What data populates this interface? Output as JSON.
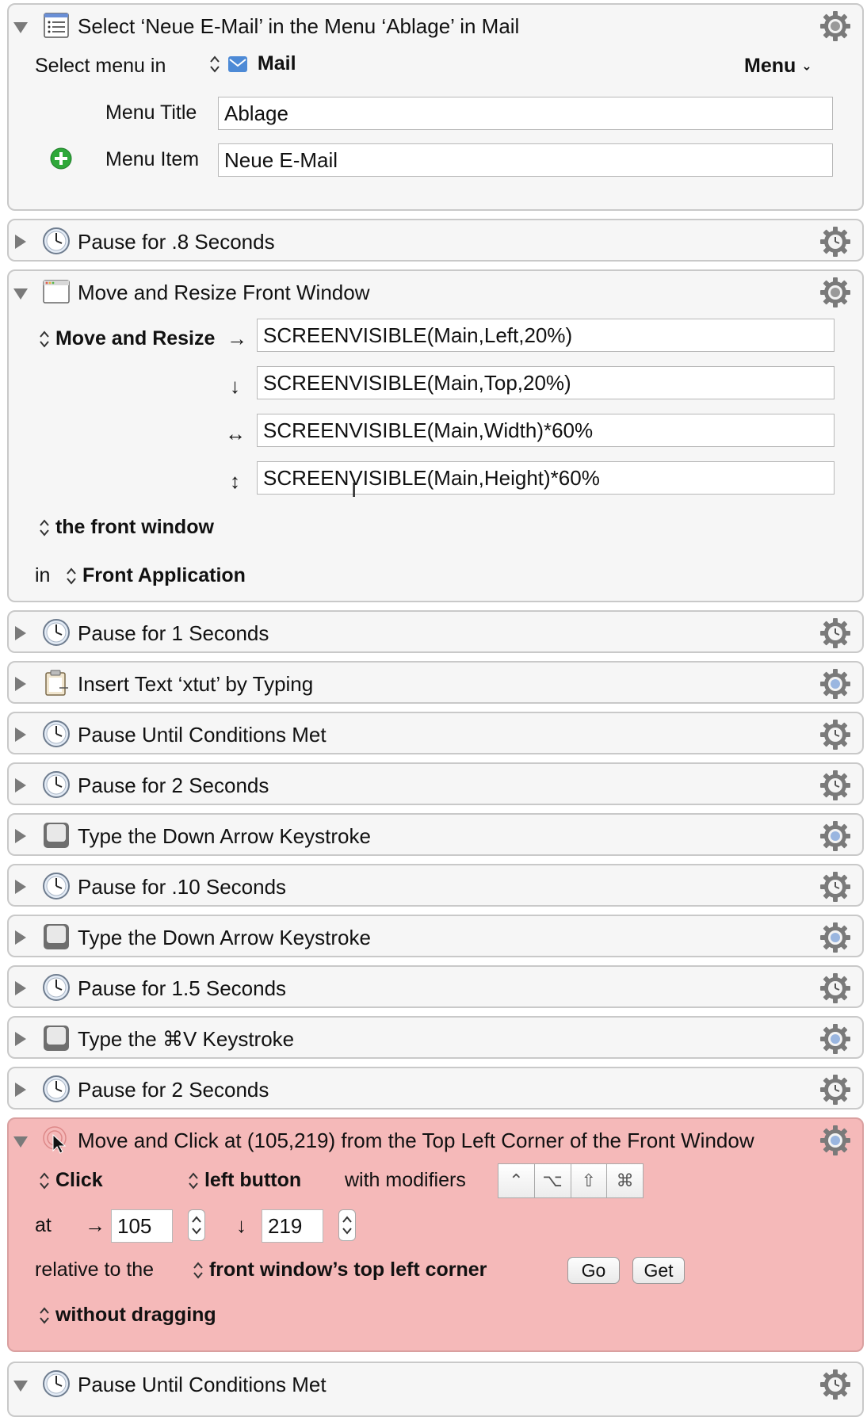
{
  "actions": [
    {
      "id": "a1",
      "title": "Select ‘Neue E-Mail’ in the Menu ‘Ablage’ in Mail",
      "icon": "menu-list-icon",
      "select_menu_label": "Select menu in",
      "app_name": "Mail",
      "menu_popup": "Menu",
      "menu_title_label": "Menu Title",
      "menu_title_value": "Ablage",
      "menu_item_label": "Menu Item",
      "menu_item_value": "Neue E-Mail"
    },
    {
      "id": "a2",
      "title": "Pause for .8 Seconds",
      "icon": "clock-icon"
    },
    {
      "id": "a3",
      "title": "Move and Resize Front Window",
      "icon": "window-icon",
      "mode": "Move and Resize",
      "left_value": "SCREENVISIBLE(Main,Left,20%)",
      "top_value": "SCREENVISIBLE(Main,Top,20%)",
      "width_value": "SCREENVISIBLE(Main,Width)*60%",
      "height_value": "SCREENVISIBLE(Main,Height)*60%",
      "target_window": "the front window",
      "in_label": "in",
      "target_app": "Front Application"
    },
    {
      "id": "a4",
      "title": "Pause for 1 Seconds",
      "icon": "clock-icon"
    },
    {
      "id": "a5",
      "title": "Insert Text ‘xtut’ by Typing",
      "icon": "clipboard-icon"
    },
    {
      "id": "a6",
      "title": "Pause Until Conditions Met",
      "icon": "clock-icon"
    },
    {
      "id": "a7",
      "title": "Pause for 2 Seconds",
      "icon": "clock-icon"
    },
    {
      "id": "a8",
      "title": "Type the Down Arrow Keystroke",
      "icon": "keycap-icon"
    },
    {
      "id": "a9",
      "title": "Pause for .10 Seconds",
      "icon": "clock-icon"
    },
    {
      "id": "a10",
      "title": "Type the Down Arrow Keystroke",
      "icon": "keycap-icon"
    },
    {
      "id": "a11",
      "title": "Pause for 1.5 Seconds",
      "icon": "clock-icon"
    },
    {
      "id": "a12",
      "title": "Type the ⌘V Keystroke",
      "icon": "keycap-icon"
    },
    {
      "id": "a13",
      "title": "Pause for 2 Seconds",
      "icon": "clock-icon"
    },
    {
      "id": "a14",
      "title": "Move and Click at (105,219) from the Top Left Corner of the Front Window",
      "icon": "mouse-click-icon",
      "action_popup": "Click",
      "button_popup": "left button",
      "modifiers_label": "with modifiers",
      "modifiers": [
        "⌃",
        "⌥",
        "⇧",
        "⌘"
      ],
      "at_label": "at",
      "x_value": "105",
      "y_value": "219",
      "relative_label": "relative to the",
      "relative_popup": "front window’s top left corner",
      "go_label": "Go",
      "get_label": "Get",
      "drag_popup": "without dragging"
    },
    {
      "id": "a15",
      "title": "Pause Until Conditions Met",
      "icon": "clock-icon"
    }
  ]
}
